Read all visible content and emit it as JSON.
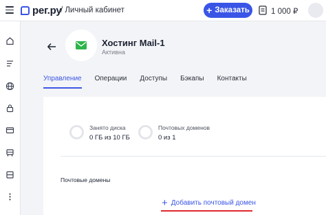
{
  "header": {
    "logo_text": "рег.ру",
    "section_title": "/ Личный кабинет",
    "order_button_label": "Заказать",
    "balance": "1 000 ₽"
  },
  "sidebar": {
    "icons": [
      "home-icon",
      "list-icon",
      "globe-icon",
      "lock-icon",
      "card-icon",
      "server-icon",
      "storage-icon",
      "more-icon"
    ]
  },
  "service": {
    "title": "Хостинг Mail-1",
    "status": "Активна"
  },
  "tabs": [
    {
      "label": "Управление",
      "active": true
    },
    {
      "label": "Операции",
      "active": false
    },
    {
      "label": "Доступы",
      "active": false
    },
    {
      "label": "Бэкапы",
      "active": false
    },
    {
      "label": "Контакты",
      "active": false
    }
  ],
  "stats": {
    "disk": {
      "label": "Занято диска",
      "value": "0 ГБ из 10 ГБ"
    },
    "domains": {
      "label": "Почтовых доменов",
      "value": "0 из 1"
    }
  },
  "mail_domains": {
    "section_label": "Почтовые домены",
    "add_link_label": "Добавить почтовый домен"
  },
  "colors": {
    "accent": "#3a55e6",
    "highlight": "#e0262d",
    "mail_icon": "#2fb44a"
  }
}
